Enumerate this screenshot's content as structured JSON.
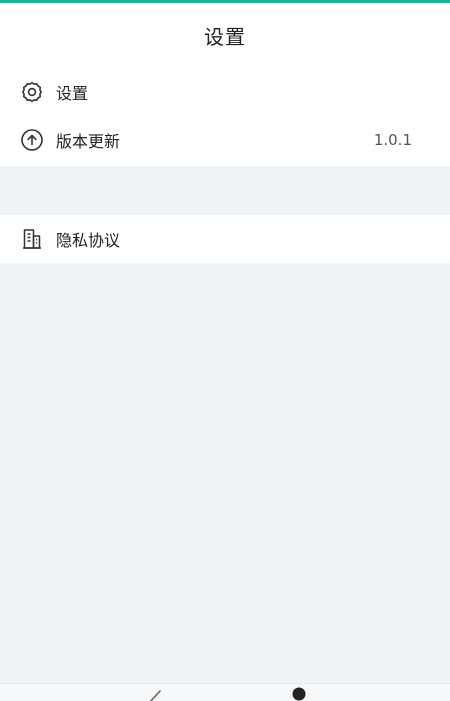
{
  "header": {
    "title": "设置"
  },
  "settings_section": {
    "items": [
      {
        "label": "设置",
        "icon": "gear-icon",
        "value": ""
      },
      {
        "label": "版本更新",
        "icon": "arrow-up-circle-icon",
        "value": "1.0.1"
      }
    ]
  },
  "privacy_section": {
    "items": [
      {
        "label": "隐私协议",
        "icon": "building-icon"
      }
    ]
  },
  "bottom_nav": {
    "icons": [
      "pen-icon",
      "user-icon"
    ]
  },
  "colors": {
    "accent": "#1bb394",
    "background": "#f1f4f7",
    "surface": "#ffffff"
  }
}
